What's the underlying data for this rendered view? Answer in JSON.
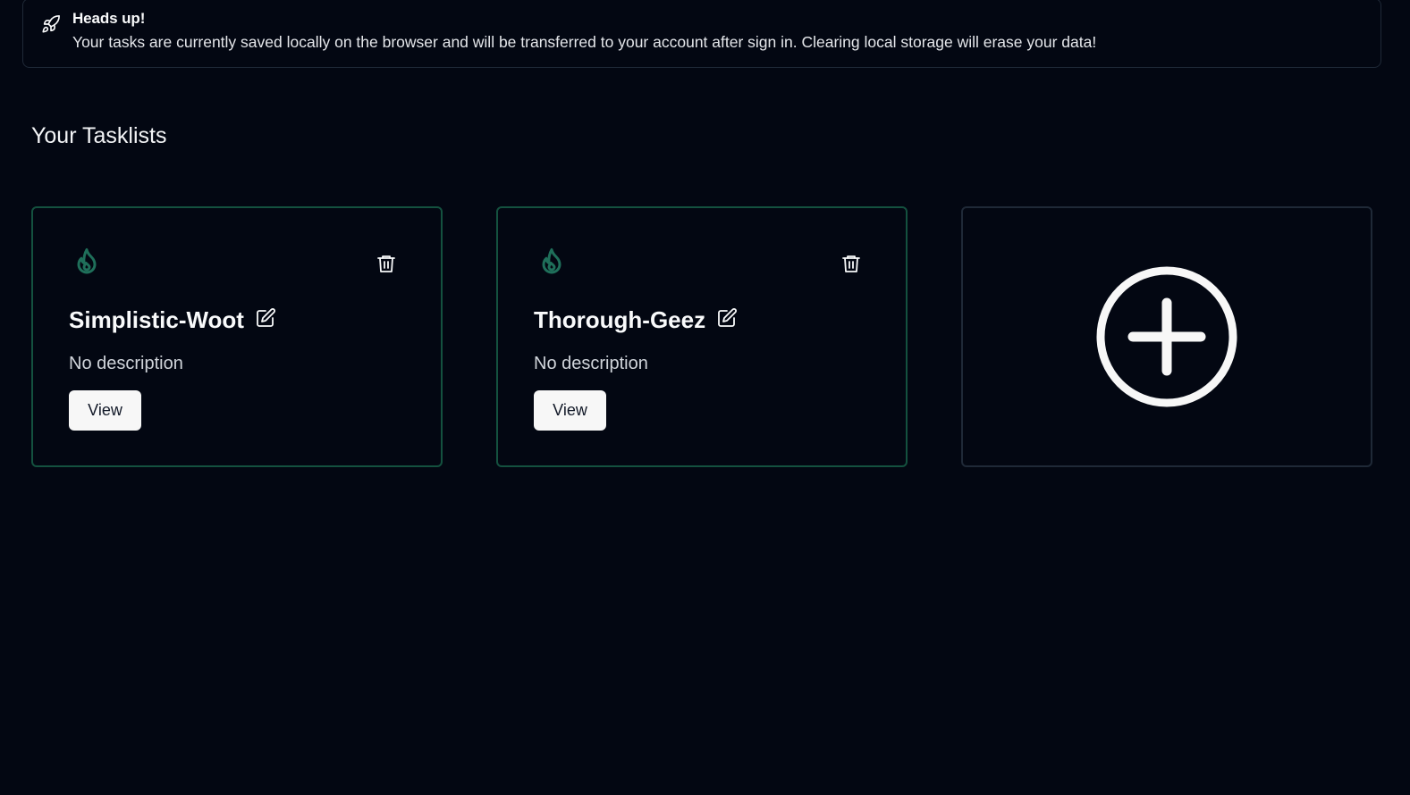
{
  "alert": {
    "icon": "rocket-icon",
    "title": "Heads up!",
    "message": "Your tasks are currently saved locally on the browser and will be transferred to your account after sign in. Clearing local storage will erase your data!"
  },
  "section": {
    "title": "Your Tasklists"
  },
  "tasklists": [
    {
      "name": "Simplistic-Woot",
      "description": "No description",
      "view_label": "View",
      "icon": "flame-icon"
    },
    {
      "name": "Thorough-Geez",
      "description": "No description",
      "view_label": "View",
      "icon": "flame-icon"
    }
  ],
  "add_card": {
    "icon": "plus-circle-icon"
  },
  "colors": {
    "background": "#030712",
    "card_border": "#14513f",
    "accent": "#1f6f5a",
    "button_bg": "#f7f7f7"
  }
}
